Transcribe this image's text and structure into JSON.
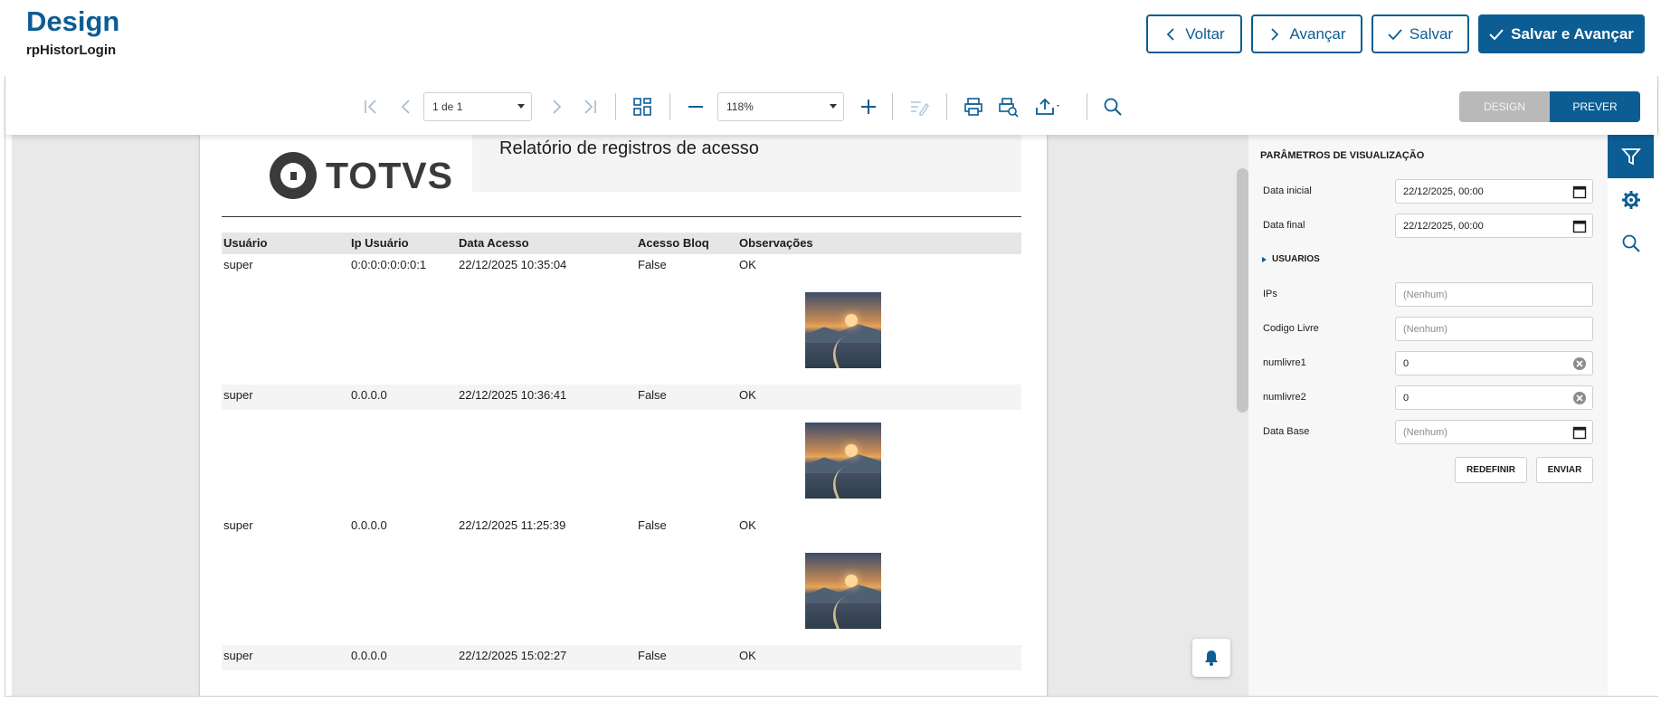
{
  "header": {
    "title": "Design",
    "subtitle": "rpHistorLogin",
    "buttons": {
      "voltar": "Voltar",
      "avancar": "Avançar",
      "salvar": "Salvar",
      "salvar_avancar": "Salvar e Avançar"
    }
  },
  "toolbar": {
    "page_select": "1 de 1",
    "zoom_select": "118%",
    "mode_design": "DESIGN",
    "mode_prever": "PREVER",
    "active_mode": "PREVER"
  },
  "report": {
    "logo_text": "TOTVS",
    "title": "Relatório de registros de acesso",
    "columns": [
      "Usuário",
      "Ip Usuário",
      "Data Acesso",
      "Acesso Bloq",
      "Observações"
    ],
    "rows": [
      [
        "super",
        "0:0:0:0:0:0:0:1",
        "22/12/2025 10:35:04",
        "False",
        "OK"
      ],
      [
        "super",
        "0.0.0.0",
        "22/12/2025 10:36:41",
        "False",
        "OK"
      ],
      [
        "super",
        "0.0.0.0",
        "22/12/2025 11:25:39",
        "False",
        "OK"
      ],
      [
        "super",
        "0.0.0.0",
        "22/12/2025 15:02:27",
        "False",
        "OK"
      ]
    ]
  },
  "panel": {
    "title": "PARÂMETROS DE VISUALIZAÇÃO",
    "data_inicial_label": "Data inicial",
    "data_inicial_value": "22/12/2025, 00:00",
    "data_final_label": "Data final",
    "data_final_value": "22/12/2025, 00:00",
    "usuarios_section": "USUARIOS",
    "ips_label": "IPs",
    "ips_placeholder": "(Nenhum)",
    "codigo_livre_label": "Codigo Livre",
    "codigo_livre_placeholder": "(Nenhum)",
    "numlivre1_label": "numlivre1",
    "numlivre1_value": "0",
    "numlivre2_label": "numlivre2",
    "numlivre2_value": "0",
    "data_base_label": "Data Base",
    "data_base_placeholder": "(Nenhum)",
    "btn_redefinir": "REDEFINIR",
    "btn_enviar": "ENVIAR"
  },
  "rail": {
    "items": [
      "filter-icon",
      "gear-icon",
      "search-icon"
    ],
    "active": "filter-icon"
  },
  "colors": {
    "primary": "#0c5d93",
    "design_toggle_inactive": "#b9b9b9"
  }
}
